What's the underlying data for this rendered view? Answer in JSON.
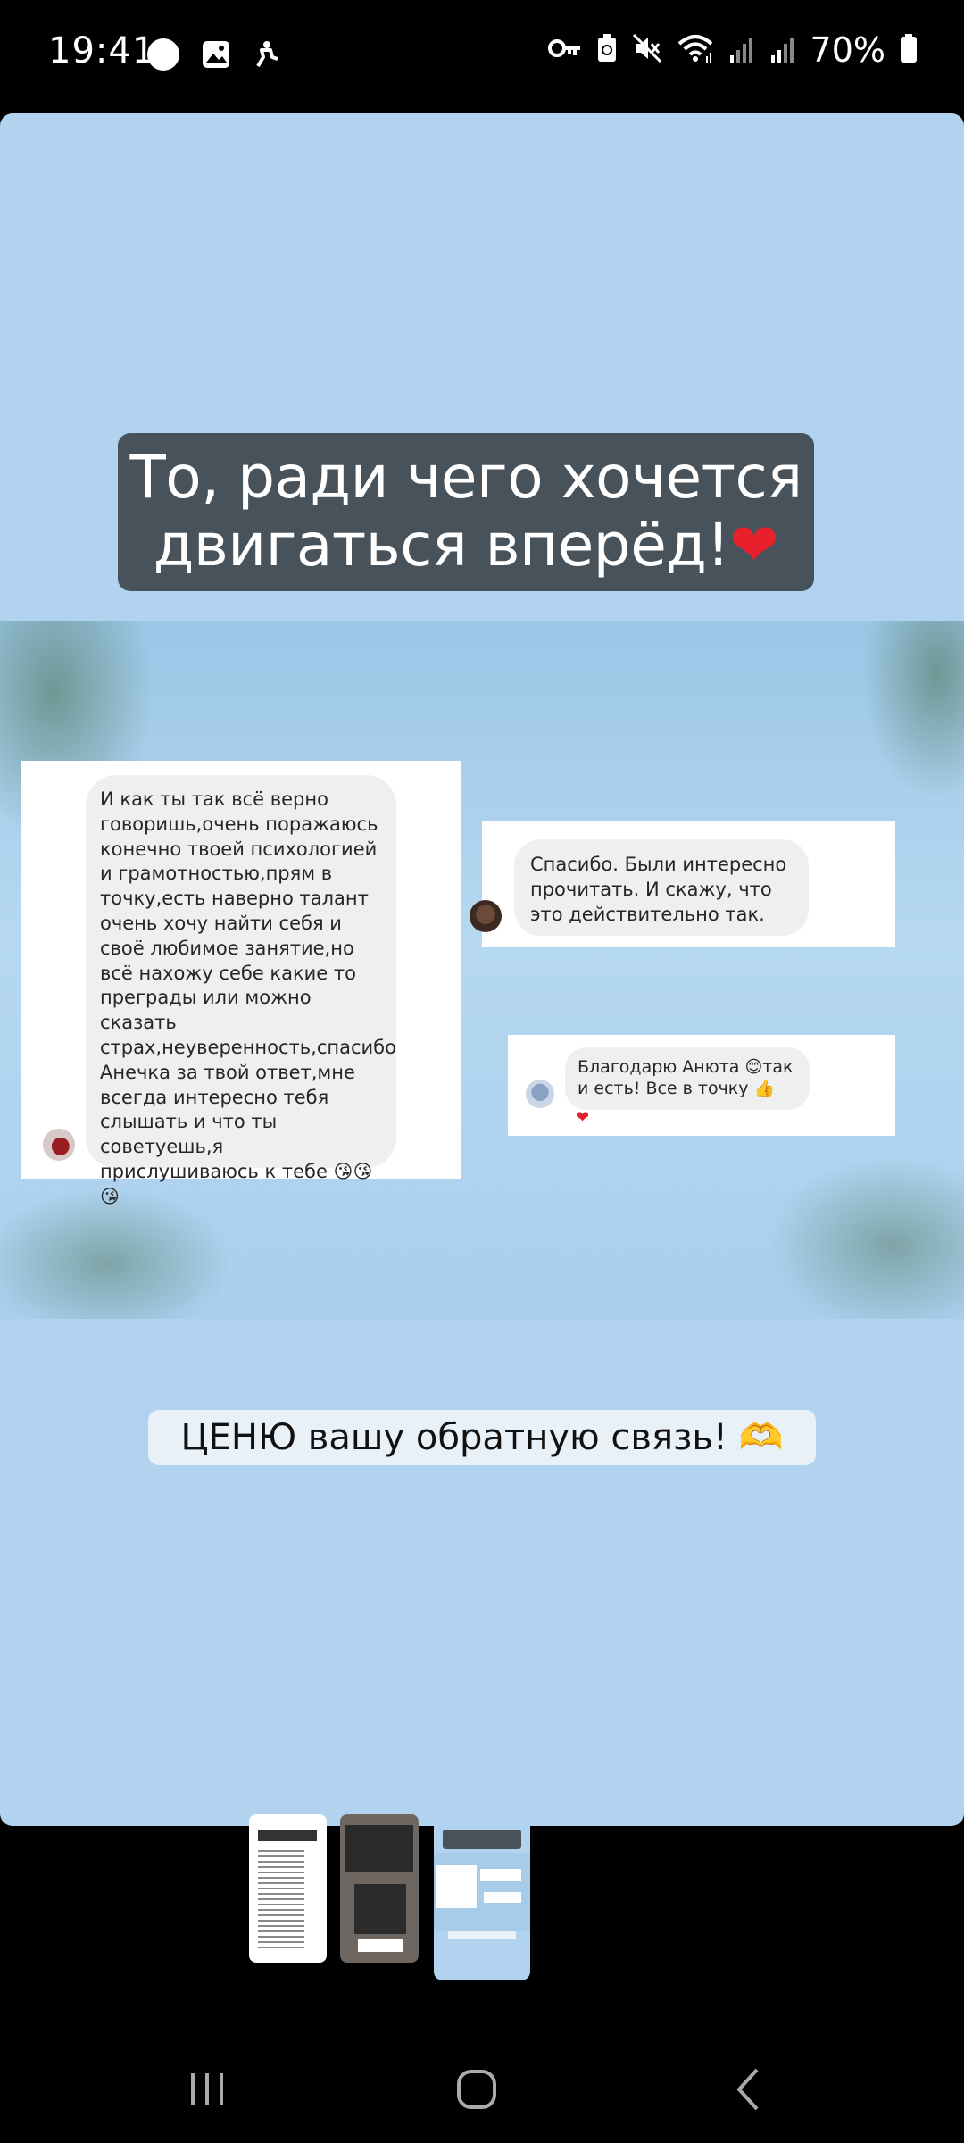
{
  "status_bar": {
    "time": "19:41",
    "battery_percent": "70%",
    "left_icons": [
      "circle-notification-icon",
      "image-icon",
      "accessibility-icon"
    ],
    "right_icons": [
      "key-icon",
      "battery-saver-icon",
      "mute-icon",
      "wifi-icon",
      "signal-icon",
      "signal-icon",
      "battery-icon"
    ]
  },
  "story": {
    "title": "То, ради чего хочется двигаться вперёд!",
    "title_emoji": "❤",
    "messages": [
      {
        "text": "И как ты так всё верно говоришь,очень поражаюсь конечно твоей психологией и грамотностью,прям в точку,есть наверно талант очень хочу найти себя и своё любимое занятие,но всё нахожу себе какие то преграды или можно сказать страх,неуверенность,спасибо Анечка за твой ответ,мне всегда интересно тебя слышать и что ты советуешь,я прислушиваюсь к тебе 😘😘😘"
      },
      {
        "text": "Спасибо. Были интересно прочитать. И скажу, что это действительно так."
      },
      {
        "text": "Благодарю Анюта 😊так и есть! Все в точку 👍",
        "reaction": "❤"
      }
    ],
    "caption": "ЦЕНЮ вашу обратную связь!",
    "caption_emoji": "🫶"
  },
  "thumbnails": [
    {
      "label": "story-1"
    },
    {
      "label": "story-2"
    },
    {
      "label": "story-3",
      "selected": true
    }
  ],
  "nav_bar": {
    "buttons": [
      "recent-apps",
      "home",
      "back"
    ]
  },
  "colors": {
    "story_background": "#b2d3ef",
    "title_box": "#48525b",
    "bubble": "#efefef"
  }
}
